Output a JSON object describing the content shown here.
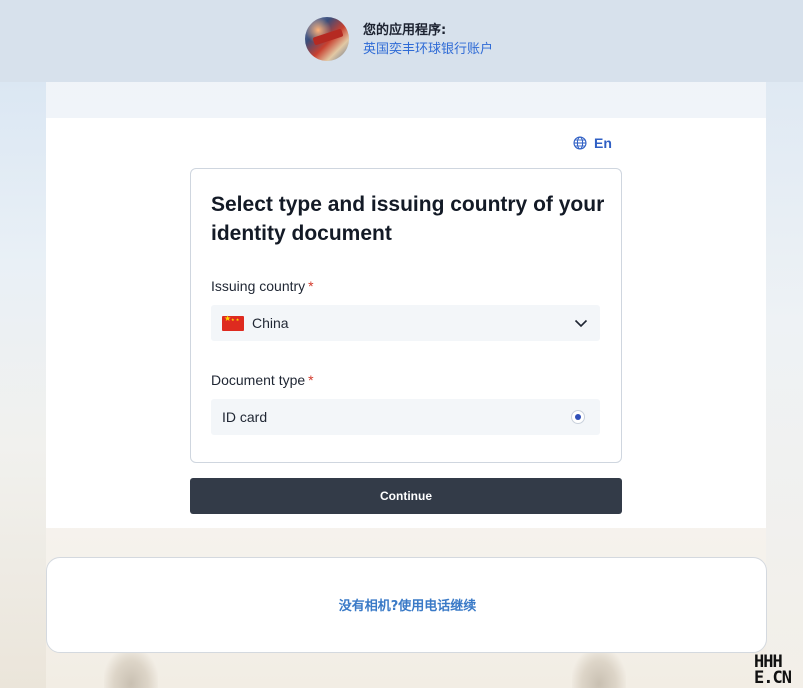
{
  "header": {
    "label": "您的应用程序:",
    "app_name": "英国奕丰环球银行账户"
  },
  "language": {
    "icon": "globe-icon",
    "label": "En"
  },
  "form": {
    "title": "Select type and issuing country of your identity document",
    "country_label": "Issuing country",
    "country_value": "China",
    "country_flag": "china-flag-icon",
    "document_label": "Document type",
    "document_value": "ID card",
    "required_mark": "*"
  },
  "continue_label": "Continue",
  "alt_option": {
    "label": "没有相机?使用电话继续"
  },
  "watermark": {
    "line1": "HHH",
    "line2": "E.CN"
  },
  "colors": {
    "accent": "#2f6bd6",
    "button": "#333b48",
    "required": "#d33a2c",
    "link": "#3a7ac7"
  }
}
